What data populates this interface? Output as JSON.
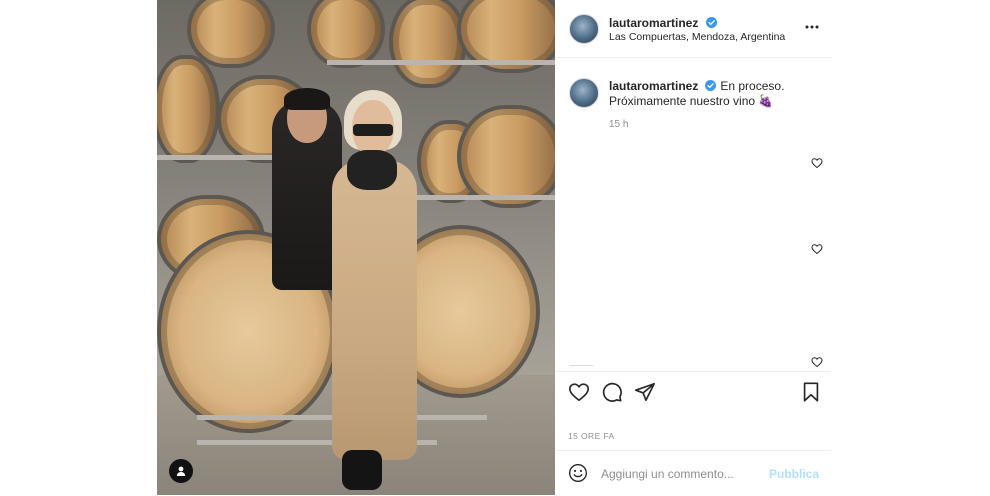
{
  "post": {
    "author": {
      "username": "lautaromartinez",
      "verified": true,
      "location": "Las Compuertas, Mendoza, Argentina"
    },
    "caption": {
      "username": "lautaromartinez",
      "text": "En proceso. Próximamente nuestro vino 🍇",
      "time": "15 h"
    },
    "date": "15 ORE FA",
    "comment": {
      "placeholder": "Aggiungi un commento...",
      "publish_label": "Pubblica"
    },
    "icons": {
      "like": "heart-icon",
      "comment": "comment-icon",
      "share": "share-icon",
      "save": "bookmark-icon",
      "more": "more-options-icon",
      "emoji": "emoji-icon",
      "tag": "user-tag-icon",
      "verified": "verified-badge-icon"
    },
    "colors": {
      "verified": "#3897f0",
      "publish_disabled": "#b2dffc",
      "meta_text": "#8e8e8e",
      "divider": "#efefef"
    }
  }
}
